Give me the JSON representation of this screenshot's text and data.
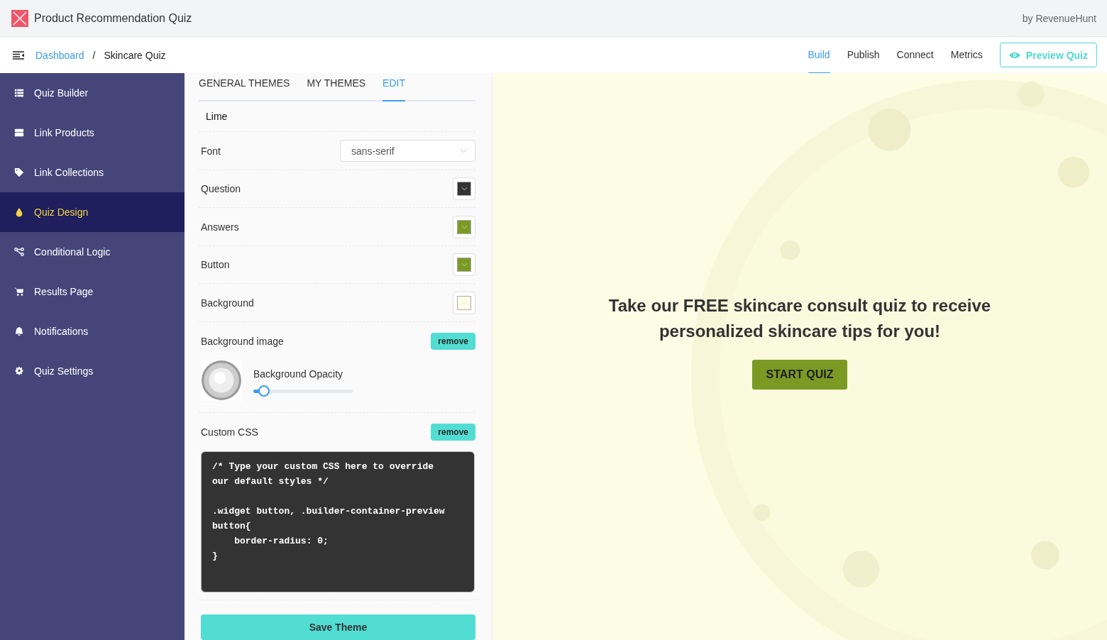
{
  "app": {
    "title": "Product Recommendation Quiz",
    "byline": "by RevenueHunt"
  },
  "nav": {
    "breadcrumb": [
      {
        "label": "Dashboard",
        "link": true
      },
      {
        "label": "/",
        "link": false
      },
      {
        "label": "Skincare Quiz",
        "link": false
      }
    ],
    "tabs": [
      {
        "label": "Build",
        "selected": true
      },
      {
        "label": "Publish",
        "selected": false
      },
      {
        "label": "Connect",
        "selected": false
      },
      {
        "label": "Metrics",
        "selected": false
      }
    ],
    "preview_button": "Preview Quiz"
  },
  "sidebar": {
    "items": [
      {
        "label": "Quiz Builder",
        "selected": false
      },
      {
        "label": "Link Products",
        "selected": false
      },
      {
        "label": "Link Collections",
        "selected": false
      },
      {
        "label": "Quiz Design",
        "selected": true
      },
      {
        "label": "Conditional Logic",
        "selected": false
      },
      {
        "label": "Results Page",
        "selected": false
      },
      {
        "label": "Notifications",
        "selected": false
      },
      {
        "label": "Quiz Settings",
        "selected": false
      }
    ]
  },
  "panel": {
    "tabs": [
      {
        "label": "GENERAL THEMES",
        "selected": false
      },
      {
        "label": "MY THEMES",
        "selected": false
      },
      {
        "label": "EDIT",
        "selected": true
      }
    ],
    "theme_name": "Lime",
    "settings": [
      {
        "label": "Font",
        "kind": "select",
        "value": "sans-serif"
      },
      {
        "label": "Question",
        "kind": "color",
        "color": "#333333"
      },
      {
        "label": "Answers",
        "kind": "color",
        "color": "#7a9a24"
      },
      {
        "label": "Button",
        "kind": "color",
        "color": "#7a9a24"
      },
      {
        "label": "Background",
        "kind": "color",
        "color": "#fffee8"
      }
    ],
    "background_image": {
      "label": "Background image",
      "remove": "remove",
      "opacity_label": "Background Opacity",
      "level": 0.1
    },
    "custom_css": {
      "label": "Custom CSS",
      "remove": "remove",
      "code": "/* Type your custom CSS here to override our default styles */\n\n.widget button, .builder-container-preview button{\n    border-radius: 0;\n}"
    },
    "save_button": "Save Theme"
  },
  "preview": {
    "headline": "Take our FREE skincare consult quiz to receive personalized skincare tips for you!",
    "start_button": "START QUIZ"
  }
}
